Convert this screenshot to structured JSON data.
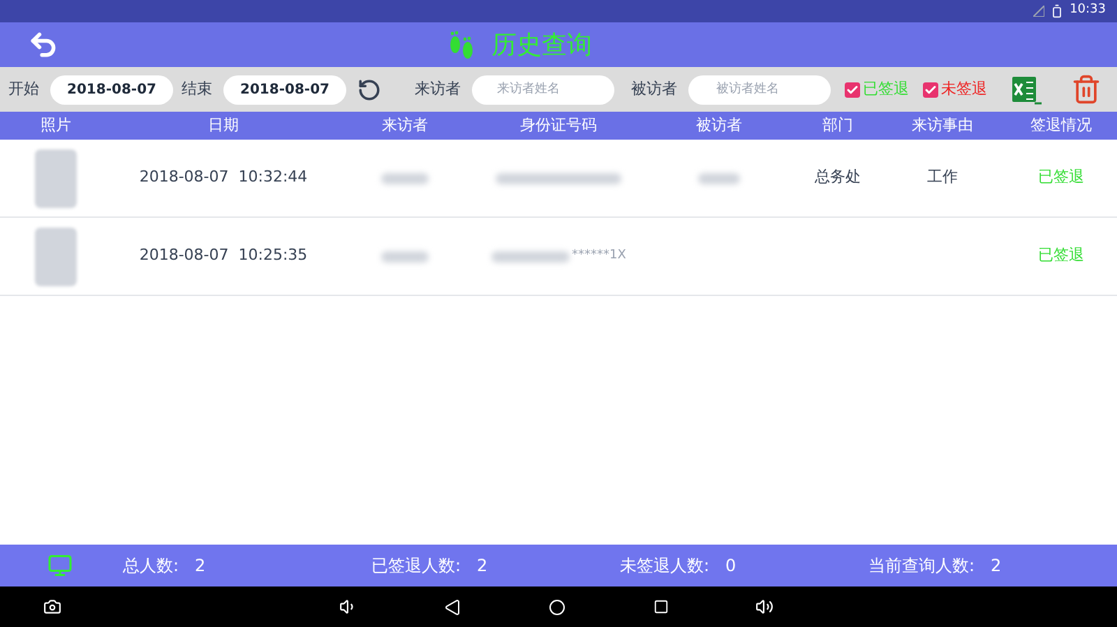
{
  "status_bar": {
    "time": "10:33"
  },
  "header": {
    "title": "历史查询"
  },
  "filters": {
    "start_label": "开始",
    "start_date": "2018-08-07",
    "end_label": "结束",
    "end_date": "2018-08-07",
    "visitor_label": "来访者",
    "visitor_placeholder": "来访者姓名",
    "host_label": "被访者",
    "host_placeholder": "被访者姓名",
    "checkboxes": [
      {
        "label": "已签退",
        "checked": true,
        "color": "#33dd33"
      },
      {
        "label": "未签退",
        "checked": true,
        "color": "#ee2222"
      }
    ]
  },
  "table": {
    "columns": [
      "照片",
      "日期",
      "来访者",
      "身份证号码",
      "被访者",
      "部门",
      "来访事由",
      "签退情况"
    ],
    "rows": [
      {
        "date": "2018-08-07  10:32:44",
        "visitor_blurred": true,
        "id_number": "",
        "host_blurred": true,
        "department": "总务处",
        "reason": "工作",
        "status": "已签退"
      },
      {
        "date": "2018-08-07  10:25:35",
        "visitor_blurred": true,
        "id_number": "******1X",
        "host_blurred": false,
        "department": "",
        "reason": "",
        "status": "已签退"
      }
    ]
  },
  "footer": {
    "stats": [
      {
        "label": "总人数:",
        "value": "2"
      },
      {
        "label": "已签退人数:",
        "value": "2"
      },
      {
        "label": "未签退人数:",
        "value": "0"
      },
      {
        "label": "当前查询人数:",
        "value": "2"
      }
    ]
  }
}
